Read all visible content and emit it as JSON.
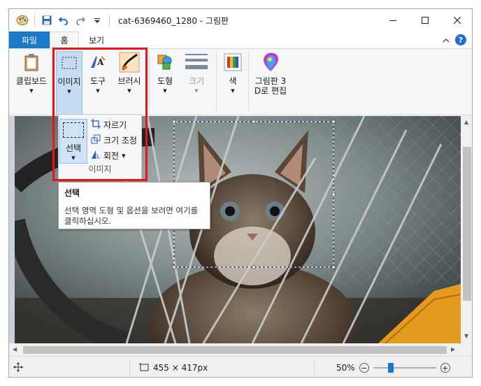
{
  "window": {
    "title": "cat-6369460_1280 - 그림판"
  },
  "tabs": {
    "file": "파일",
    "home": "홈",
    "view": "보기"
  },
  "help_label": "?",
  "ribbon": {
    "clipboard": "클립보드",
    "image": "이미지",
    "tools": "도구",
    "brushes": "브러시",
    "shapes": "도형",
    "size": "크기",
    "colors": "색",
    "paint3d": "그림판 3\nD로 편집"
  },
  "image_panel": {
    "select": "선택",
    "crop": "자르기",
    "resize": "크기 조정",
    "rotate": "회전",
    "group_label": "이미지"
  },
  "tooltip": {
    "title": "선택",
    "body": "선택 영역 도형 및 옵션을 보려면 여기를 클릭하십시오."
  },
  "status": {
    "dimensions": "455 × 417px",
    "zoom": "50%",
    "zoom_level_fraction": 0.5
  },
  "colors": {
    "accent": "#1979ca",
    "highlight": "#e81515"
  }
}
